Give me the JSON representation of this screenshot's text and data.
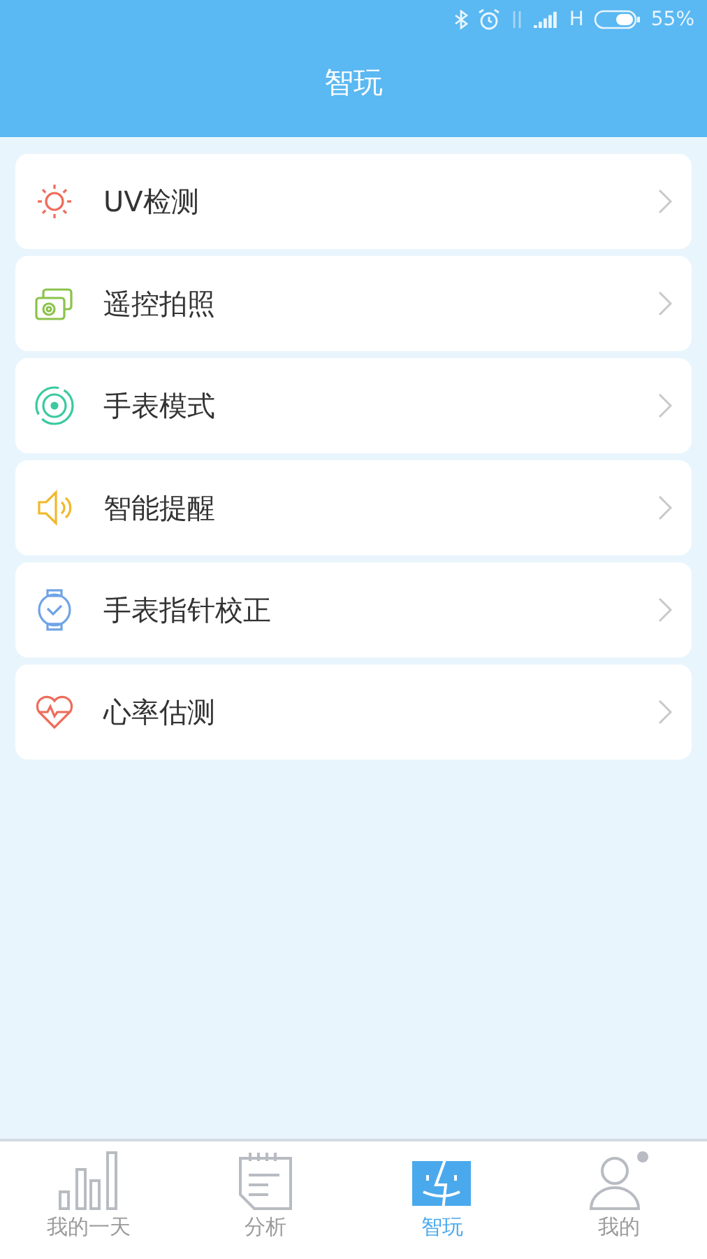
{
  "status_bar": {
    "network": "H",
    "battery": "55%"
  },
  "header": {
    "title": "智玩"
  },
  "items": [
    {
      "kind": "sun",
      "label": "UV检测"
    },
    {
      "kind": "camera",
      "label": "遥控拍照"
    },
    {
      "kind": "target",
      "label": "手表模式"
    },
    {
      "kind": "speaker",
      "label": "智能提醒"
    },
    {
      "kind": "watch",
      "label": "手表指针校正"
    },
    {
      "kind": "heart",
      "label": "心率估测"
    }
  ],
  "tabs": [
    {
      "kind": "bars",
      "label": "我的一天",
      "selected": false
    },
    {
      "kind": "notepad",
      "label": "分析",
      "selected": false
    },
    {
      "kind": "face",
      "label": "智玩",
      "selected": true
    },
    {
      "kind": "person",
      "label": "我的",
      "selected": false
    }
  ]
}
